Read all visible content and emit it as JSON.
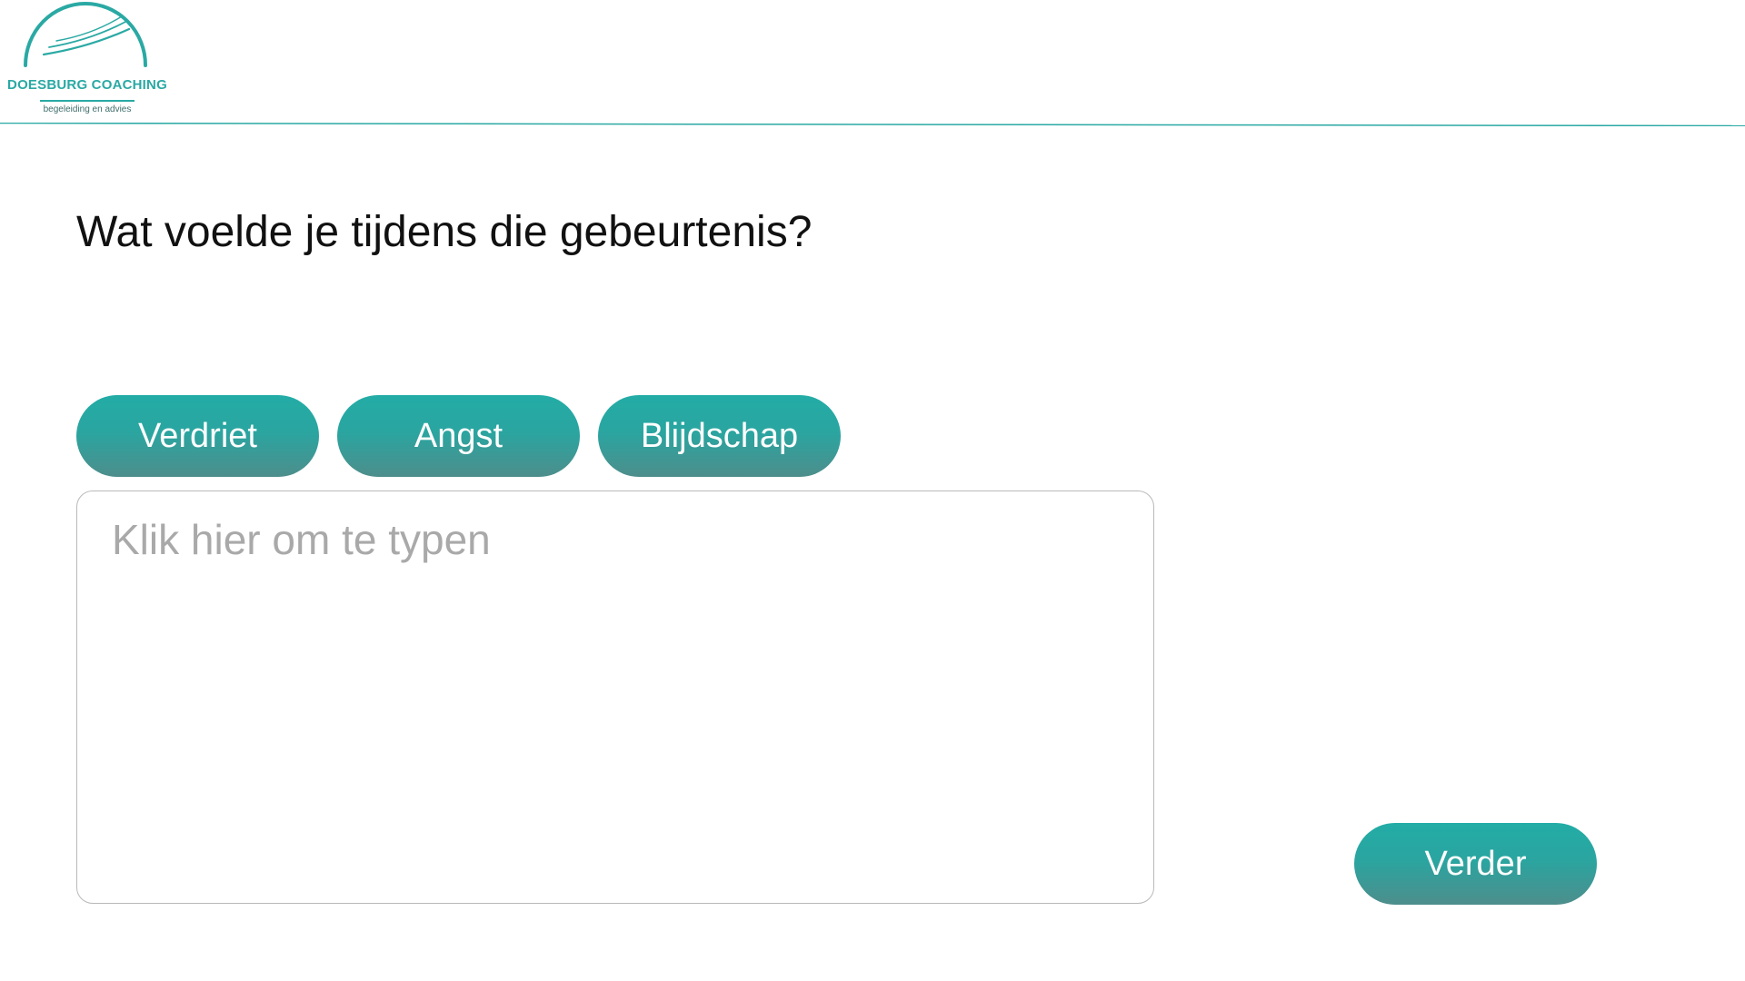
{
  "brand": {
    "name": "DOESBURG COACHING",
    "tagline": "begeleiding en advies",
    "accent_color": "#2aa9a4",
    "logo_icon": "arch-swoosh-icon"
  },
  "question": {
    "title": "Wat voelde je tijdens die gebeurtenis?"
  },
  "emotion_options": [
    {
      "label": "Verdriet"
    },
    {
      "label": "Angst"
    },
    {
      "label": "Blijdschap"
    }
  ],
  "answer_input": {
    "placeholder": "Klik hier om te typen",
    "value": ""
  },
  "navigation": {
    "next_label": "Verder"
  },
  "colors": {
    "button_top": "#23aca6",
    "button_bottom": "#4d8e8c",
    "button_text": "#ffffff",
    "input_border": "#b9b9b9",
    "placeholder": "#a9a9a9"
  }
}
